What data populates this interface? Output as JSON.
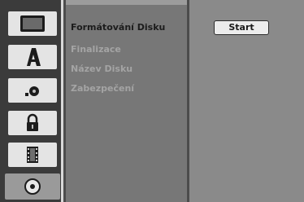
{
  "sidebar": {
    "icons": [
      {
        "name": "tv-icon",
        "active": false
      },
      {
        "name": "language-icon",
        "active": false
      },
      {
        "name": "audio-icon",
        "active": false
      },
      {
        "name": "lock-icon",
        "active": false
      },
      {
        "name": "film-icon",
        "active": false
      },
      {
        "name": "disc-icon",
        "active": true
      }
    ]
  },
  "menu": {
    "items": [
      {
        "label": "Formátování Disku",
        "selected": true
      },
      {
        "label": "Finalizace",
        "selected": false
      },
      {
        "label": "Název Disku",
        "selected": false
      },
      {
        "label": "Zabezpečení",
        "selected": false
      }
    ]
  },
  "panel": {
    "start_label": "Start"
  }
}
